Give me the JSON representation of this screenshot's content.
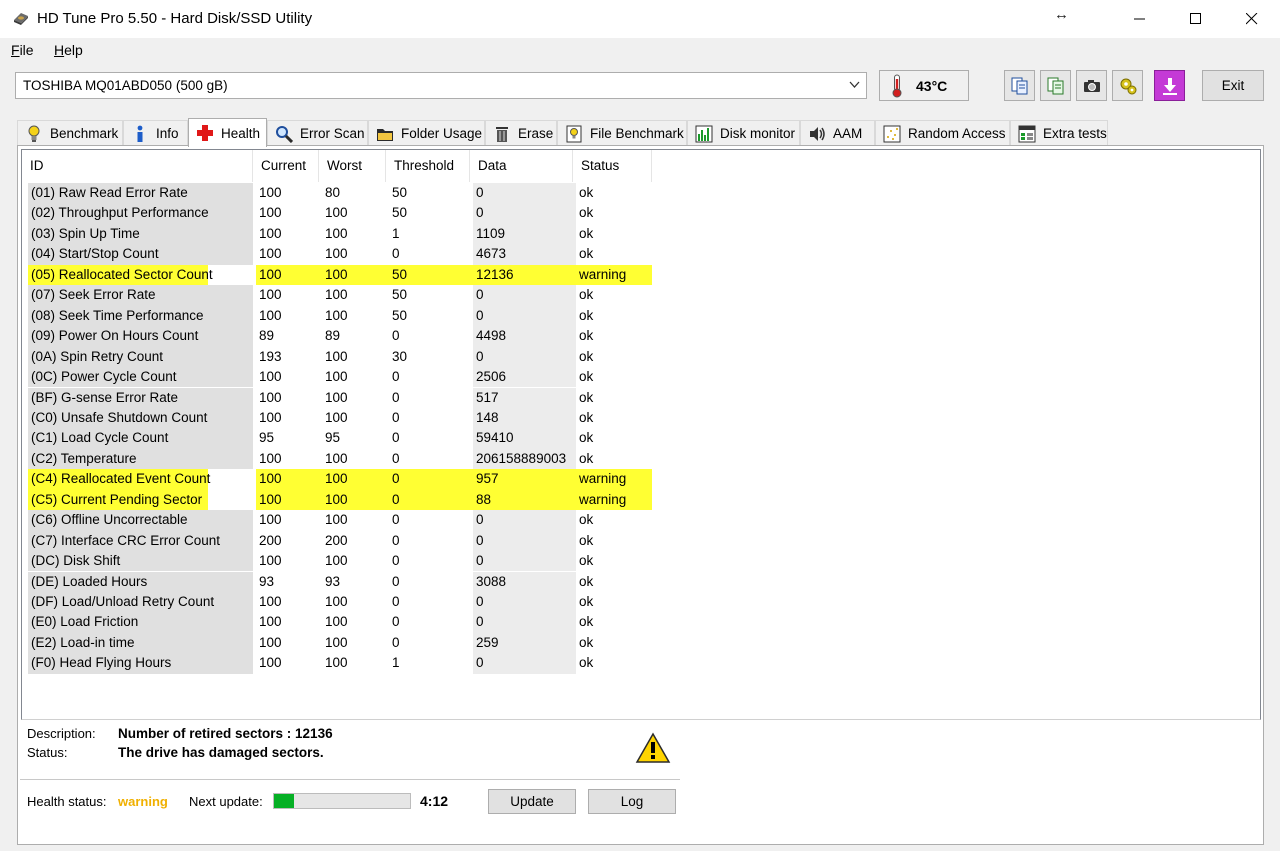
{
  "window": {
    "title": "HD Tune Pro 5.50 - Hard Disk/SSD Utility"
  },
  "menu": {
    "file": {
      "u": "F",
      "rest": "ile"
    },
    "help": {
      "u": "H",
      "rest": "elp"
    }
  },
  "toolbar": {
    "drive": "TOSHIBA MQ01ABD050 (500 gB)",
    "temperature": "43°C",
    "exit_label": "Exit"
  },
  "tabs": [
    {
      "label": "Benchmark",
      "icon": "lightbulb-icon"
    },
    {
      "label": "Info",
      "icon": "info-icon"
    },
    {
      "label": "Health",
      "icon": "red-cross-icon"
    },
    {
      "label": "Error Scan",
      "icon": "magnifier-icon"
    },
    {
      "label": "Folder Usage",
      "icon": "folder-icon"
    },
    {
      "label": "Erase",
      "icon": "trash-icon"
    },
    {
      "label": "File Benchmark",
      "icon": "file-benchmark-icon"
    },
    {
      "label": "Disk monitor",
      "icon": "disk-monitor-icon"
    },
    {
      "label": "AAM",
      "icon": "speaker-icon"
    },
    {
      "label": "Random Access",
      "icon": "random-access-icon"
    },
    {
      "label": "Extra tests",
      "icon": "extra-tests-icon"
    }
  ],
  "health": {
    "columns": [
      "ID",
      "Current",
      "Worst",
      "Threshold",
      "Data",
      "Status"
    ],
    "rows": [
      {
        "id": "(01) Raw Read Error Rate",
        "current": "100",
        "worst": "80",
        "threshold": "50",
        "data": "0",
        "status": "ok"
      },
      {
        "id": "(02) Throughput Performance",
        "current": "100",
        "worst": "100",
        "threshold": "50",
        "data": "0",
        "status": "ok"
      },
      {
        "id": "(03) Spin Up Time",
        "current": "100",
        "worst": "100",
        "threshold": "1",
        "data": "1109",
        "status": "ok"
      },
      {
        "id": "(04) Start/Stop Count",
        "current": "100",
        "worst": "100",
        "threshold": "0",
        "data": "4673",
        "status": "ok"
      },
      {
        "id": "(05) Reallocated Sector Count",
        "current": "100",
        "worst": "100",
        "threshold": "50",
        "data": "12136",
        "status": "warning"
      },
      {
        "id": "(07) Seek Error Rate",
        "current": "100",
        "worst": "100",
        "threshold": "50",
        "data": "0",
        "status": "ok"
      },
      {
        "id": "(08) Seek Time Performance",
        "current": "100",
        "worst": "100",
        "threshold": "50",
        "data": "0",
        "status": "ok"
      },
      {
        "id": "(09) Power On Hours Count",
        "current": "89",
        "worst": "89",
        "threshold": "0",
        "data": "4498",
        "status": "ok"
      },
      {
        "id": "(0A) Spin Retry Count",
        "current": "193",
        "worst": "100",
        "threshold": "30",
        "data": "0",
        "status": "ok"
      },
      {
        "id": "(0C) Power Cycle Count",
        "current": "100",
        "worst": "100",
        "threshold": "0",
        "data": "2506",
        "status": "ok"
      },
      {
        "id": "(BF) G-sense Error Rate",
        "current": "100",
        "worst": "100",
        "threshold": "0",
        "data": "517",
        "status": "ok"
      },
      {
        "id": "(C0) Unsafe Shutdown Count",
        "current": "100",
        "worst": "100",
        "threshold": "0",
        "data": "148",
        "status": "ok"
      },
      {
        "id": "(C1) Load Cycle Count",
        "current": "95",
        "worst": "95",
        "threshold": "0",
        "data": "59410",
        "status": "ok"
      },
      {
        "id": "(C2) Temperature",
        "current": "100",
        "worst": "100",
        "threshold": "0",
        "data": "206158889003",
        "status": "ok"
      },
      {
        "id": "(C4) Reallocated Event Count",
        "current": "100",
        "worst": "100",
        "threshold": "0",
        "data": "957",
        "status": "warning"
      },
      {
        "id": "(C5) Current Pending Sector",
        "current": "100",
        "worst": "100",
        "threshold": "0",
        "data": "88",
        "status": "warning"
      },
      {
        "id": "(C6) Offline Uncorrectable",
        "current": "100",
        "worst": "100",
        "threshold": "0",
        "data": "0",
        "status": "ok"
      },
      {
        "id": "(C7) Interface CRC Error Count",
        "current": "200",
        "worst": "200",
        "threshold": "0",
        "data": "0",
        "status": "ok"
      },
      {
        "id": "(DC) Disk Shift",
        "current": "100",
        "worst": "100",
        "threshold": "0",
        "data": "0",
        "status": "ok"
      },
      {
        "id": "(DE) Loaded Hours",
        "current": "93",
        "worst": "93",
        "threshold": "0",
        "data": "3088",
        "status": "ok"
      },
      {
        "id": "(DF) Load/Unload Retry Count",
        "current": "100",
        "worst": "100",
        "threshold": "0",
        "data": "0",
        "status": "ok"
      },
      {
        "id": "(E0) Load Friction",
        "current": "100",
        "worst": "100",
        "threshold": "0",
        "data": "0",
        "status": "ok"
      },
      {
        "id": "(E2) Load-in time",
        "current": "100",
        "worst": "100",
        "threshold": "0",
        "data": "259",
        "status": "ok"
      },
      {
        "id": "(F0) Head Flying Hours",
        "current": "100",
        "worst": "100",
        "threshold": "1",
        "data": "0",
        "status": "ok"
      }
    ]
  },
  "details": {
    "description_label": "Description:",
    "description_value": "Number of retired sectors : 12136",
    "status_label": "Status:",
    "status_value": "The drive has damaged sectors."
  },
  "footer": {
    "health_label": "Health status:",
    "health_value": "warning",
    "next_update_label": "Next update:",
    "progress_fraction": 0.15,
    "countdown": "4:12",
    "update_label": "Update",
    "log_label": "Log"
  },
  "colors": {
    "warning_row": "#ffff33",
    "health_warning_text": "#f0b000",
    "progress_fill": "#06b025"
  }
}
